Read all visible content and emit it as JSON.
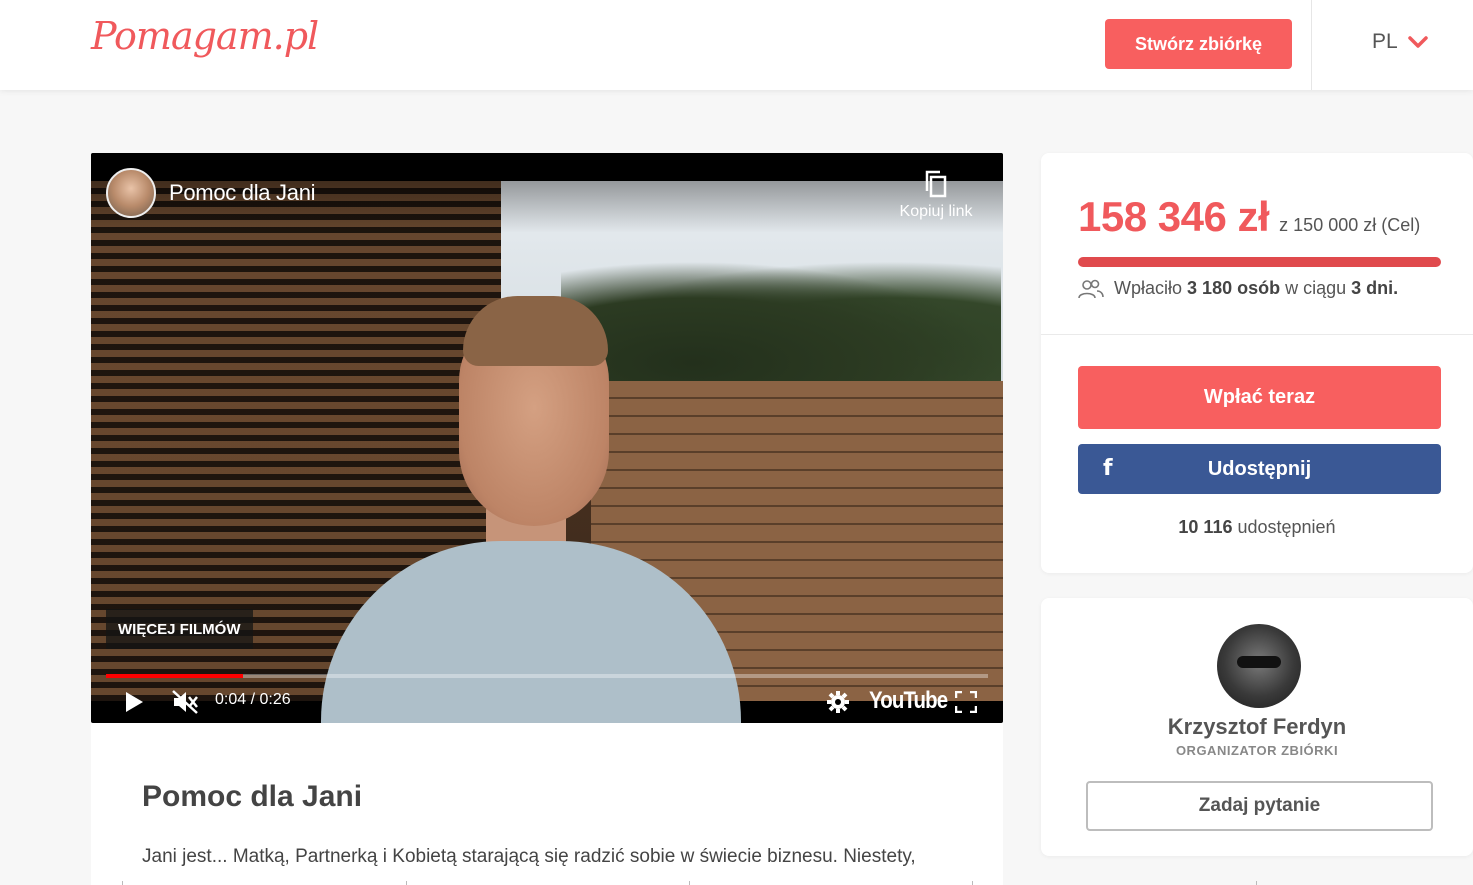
{
  "header": {
    "logo": "Pomagam.pl",
    "create_button": "Stwórz zbiórkę",
    "language": "PL"
  },
  "video": {
    "title": "Pomoc dla Jani",
    "copy_link_label": "Kopiuj link",
    "more_videos_label": "WIĘCEJ FILMÓW",
    "time": "0:04 / 0:26",
    "progress": 0.155,
    "youtube_label": "YouTube"
  },
  "campaign": {
    "title": "Pomoc dla Jani",
    "intro": "Jani jest... Matką, Partnerką i Kobietą starającą się radzić sobie w świecie biznesu. Niestety,"
  },
  "donate_card": {
    "amount": "158 346 zł",
    "goal": "z 150 000 zł (Cel)",
    "progress": 1.0,
    "donors_prefix": "Wpłaciło",
    "donors_count": "3 180 osób",
    "donors_middle": "w ciągu",
    "donors_days": "3 dni.",
    "pay_button": "Wpłać teraz",
    "share_button": "Udostępnij",
    "shares_count": "10 116",
    "shares_label": "udostępnień"
  },
  "organizer": {
    "name": "Krzysztof Ferdyn",
    "role": "ORGANIZATOR ZBIÓRKI",
    "ask_button": "Zadaj pytanie"
  },
  "colors": {
    "brand": "#f85f5f",
    "facebook": "#3a5895"
  }
}
